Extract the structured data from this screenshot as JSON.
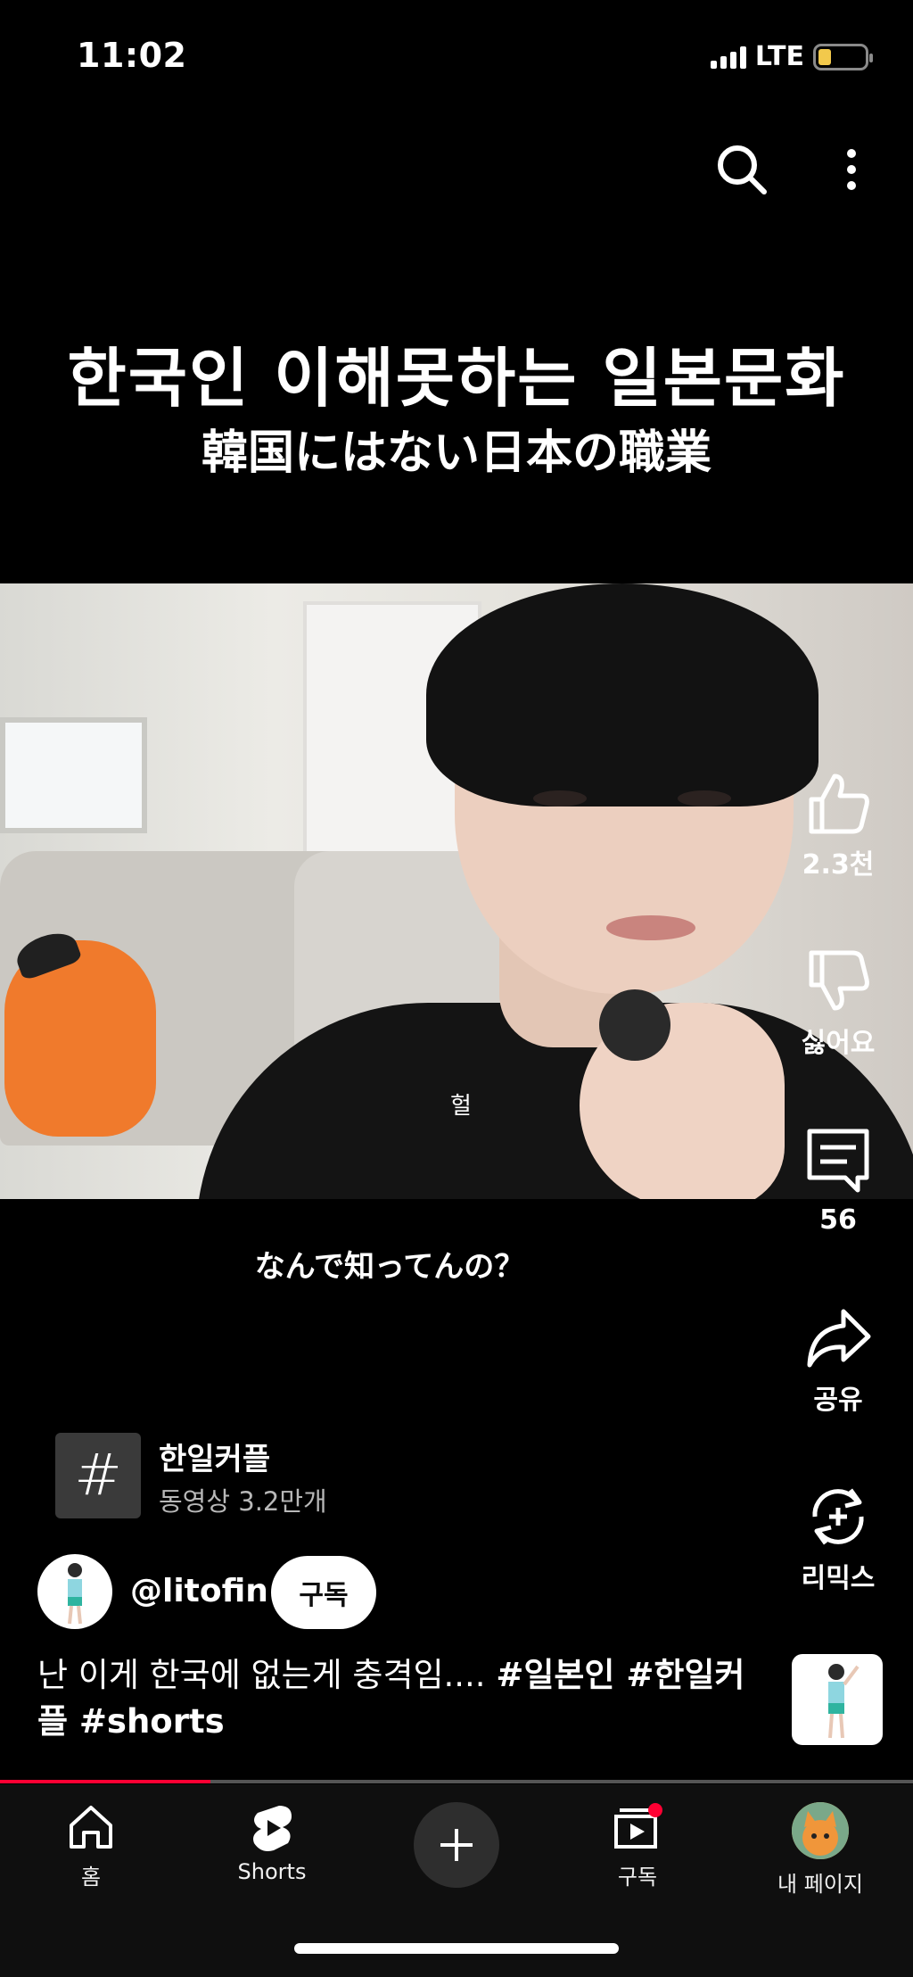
{
  "status_bar": {
    "time": "11:02",
    "network": "LTE"
  },
  "video": {
    "overlay_title_ko": "한국인 이해못하는 일본문화",
    "overlay_title_ja": "韓国にはない日本の職業",
    "in_video_caption": "헐",
    "subtitle": "なんで知ってんの？"
  },
  "actions": {
    "like_count": "2.3천",
    "dislike_label": "싫어요",
    "comment_count": "56",
    "share_label": "공유",
    "remix_label": "리믹스"
  },
  "hashtag": {
    "symbol": "#",
    "name": "한일커플",
    "video_count": "동영상 3.2만개"
  },
  "channel": {
    "handle": "@litofin",
    "subscribe_label": "구독"
  },
  "description": {
    "text": "난 이게 한국에 없는게 충격임.... ",
    "tags": "#일본인 #한일커플 #shorts"
  },
  "playback": {
    "progress_percent": 23
  },
  "nav": {
    "home": "홈",
    "shorts": "Shorts",
    "subscriptions": "구독",
    "me": "내 페이지"
  },
  "colors": {
    "accent": "#ff0033",
    "background": "#000000",
    "battery": "#f2c94c"
  }
}
